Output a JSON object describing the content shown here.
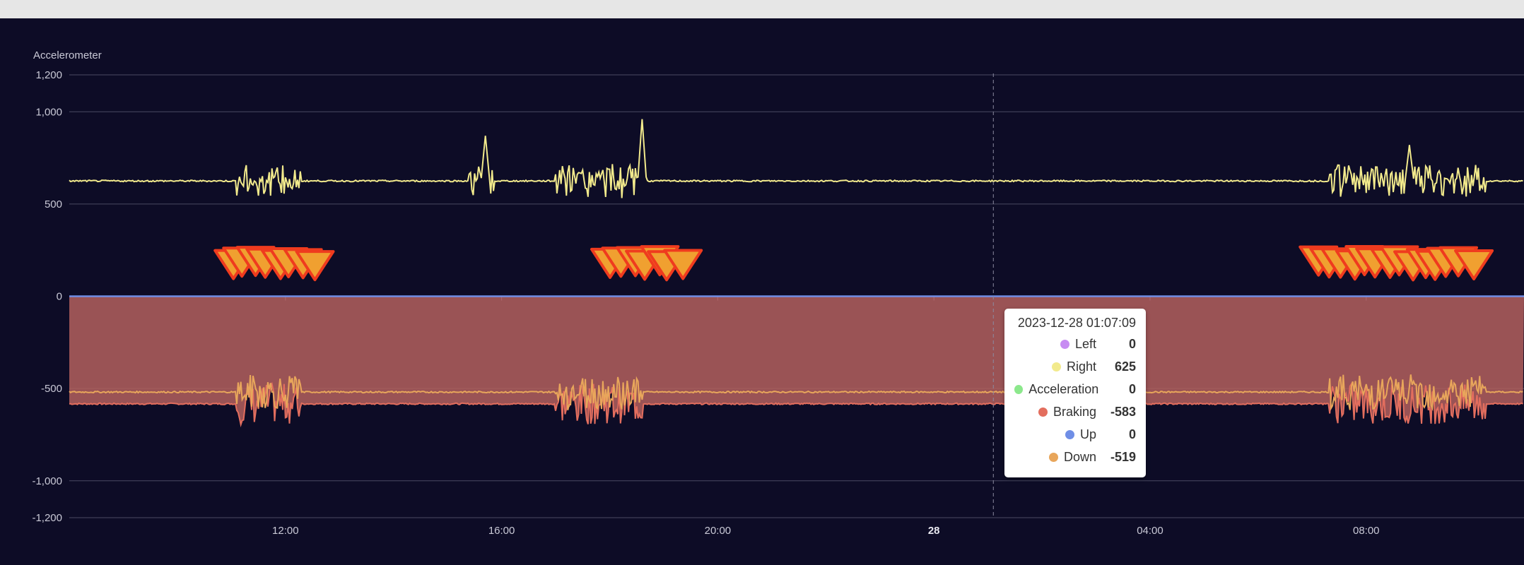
{
  "window": {
    "chrome": ""
  },
  "chart_data": {
    "type": "line",
    "title": "Accelerometer",
    "ylim": [
      -1200,
      1200
    ],
    "yticks": [
      {
        "value": 1200,
        "label": "1,200"
      },
      {
        "value": 1000,
        "label": "1,000"
      },
      {
        "value": 500,
        "label": "500"
      },
      {
        "value": 0,
        "label": "0"
      },
      {
        "value": -500,
        "label": "-500"
      },
      {
        "value": -1000,
        "label": "-1,000"
      },
      {
        "value": -1200,
        "label": "-1,200"
      }
    ],
    "x_range": [
      "2023-12-27 08:00",
      "2023-12-28 10:55"
    ],
    "xticks": [
      {
        "hour": 12,
        "label": "12:00",
        "bold": false
      },
      {
        "hour": 16,
        "label": "16:00",
        "bold": false
      },
      {
        "hour": 20,
        "label": "20:00",
        "bold": false
      },
      {
        "hour": 24,
        "label": "28",
        "bold": true
      },
      {
        "hour": 28,
        "label": "04:00",
        "bold": false
      },
      {
        "hour": 32,
        "label": "08:00",
        "bold": false
      }
    ],
    "grid": true,
    "series": [
      {
        "name": "Left",
        "color": "#c78cf2",
        "baseline": 0
      },
      {
        "name": "Right",
        "color": "#f2ea8c",
        "baseline": 625,
        "bursts": [
          [
            11.1,
            12.3
          ],
          [
            15.4,
            15.9
          ],
          [
            17.0,
            18.6
          ],
          [
            31.3,
            34.2
          ]
        ],
        "spikes": [
          {
            "hour": 18.6,
            "value": 960
          },
          {
            "hour": 15.7,
            "value": 870
          },
          {
            "hour": 32.8,
            "value": 820
          }
        ]
      },
      {
        "name": "Acceleration",
        "color": "#8ce88c",
        "baseline": 0
      },
      {
        "name": "Braking",
        "color": "#e36e5e",
        "baseline": -583,
        "bursts": [
          [
            11.1,
            12.3
          ],
          [
            17.0,
            18.6
          ],
          [
            31.3,
            34.2
          ]
        ]
      },
      {
        "name": "Up",
        "color": "#6f8ee6",
        "baseline": 0
      },
      {
        "name": "Down",
        "color": "#e8a65b",
        "baseline": -519,
        "bursts": [
          [
            11.1,
            12.3
          ],
          [
            17.0,
            18.6
          ],
          [
            31.3,
            34.2
          ]
        ]
      }
    ],
    "event_markers": {
      "value": 180,
      "groups": [
        [
          11.0,
          12.6
        ],
        [
          18.0,
          19.5
        ],
        [
          31.1,
          34.0
        ]
      ],
      "color_fill": "#f0a030",
      "color_stroke": "#ef3b1e"
    },
    "crosshair_hour": 25.1,
    "tooltip": {
      "time": "2023-12-28 01:07:09",
      "rows": [
        {
          "name": "Left",
          "value": "0",
          "color": "#c78cf2"
        },
        {
          "name": "Right",
          "value": "625",
          "color": "#f2ea8c"
        },
        {
          "name": "Acceleration",
          "value": "0",
          "color": "#8ce88c"
        },
        {
          "name": "Braking",
          "value": "-583",
          "color": "#e36e5e"
        },
        {
          "name": "Up",
          "value": "0",
          "color": "#6f8ee6"
        },
        {
          "name": "Down",
          "value": "-519",
          "color": "#e8a65b"
        }
      ]
    }
  }
}
